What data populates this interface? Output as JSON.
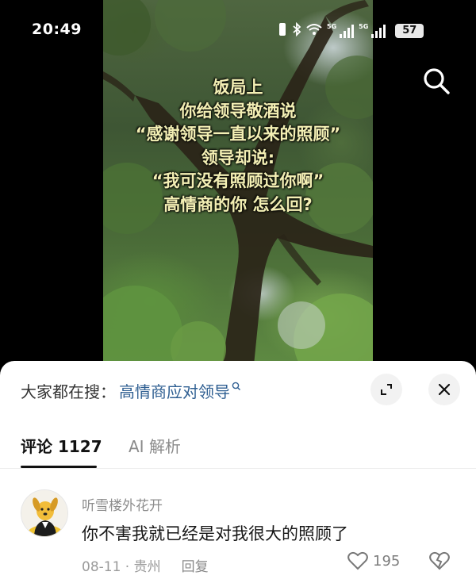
{
  "status_bar": {
    "time": "20:49",
    "network_1": "5G",
    "network_2": "5G",
    "battery": "57"
  },
  "video": {
    "caption_lines": [
      "饭局上",
      "你给领导敬酒说",
      "“感谢领导一直以来的照顾”",
      "领导却说:",
      "“我可没有照顾过你啊”",
      "高情商的你 怎么回?"
    ],
    "caption_color": "#f3efb4",
    "search_icon": "search-icon"
  },
  "sheet": {
    "hot_search_label": "大家都在搜：",
    "hot_search_term": "高情商应对领导",
    "hot_search_color": "#2f5f92",
    "expand_icon": "expand-icon",
    "close_icon": "close-icon"
  },
  "tabs": {
    "comments": "评论 1127",
    "ai": "AI 解析"
  },
  "comment": {
    "user": "听雪楼外花开",
    "text": "你不害我就已经是对我很大的照顾了",
    "date": "08-11",
    "location": "贵州",
    "date_location": "08-11 · 贵州",
    "reply": "回复",
    "likes": "195",
    "avatar_icon": "cartoon-dog-avatar"
  }
}
